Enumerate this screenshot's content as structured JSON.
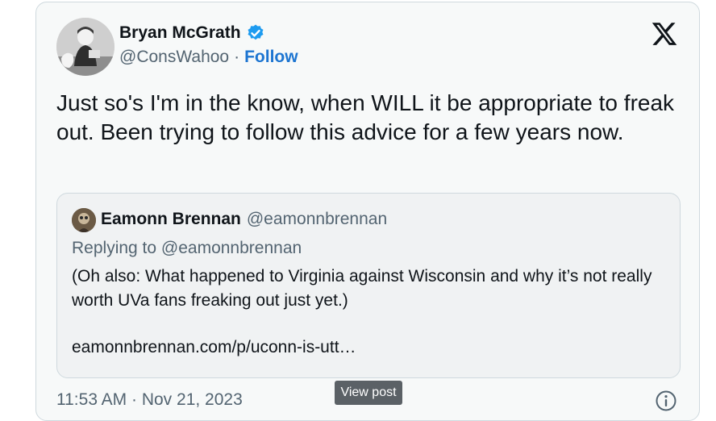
{
  "author": {
    "name": "Bryan McGrath",
    "handle": "@ConsWahoo",
    "separator": "·",
    "follow_label": "Follow",
    "verified_icon": "verified-badge-icon"
  },
  "tweet": {
    "text": "Just so's I'm in the know, when WILL it be appropriate to freak out. Been trying to follow this advice for a few years now."
  },
  "quoted": {
    "name": "Eamonn Brennan",
    "handle": "@eamonnbrennan",
    "replying_to": "Replying to @eamonnbrennan",
    "text": "(Oh also: What happened to Virginia against Wisconsin and why it’s not really worth UVa fans freaking out just yet.)",
    "link": "eamonnbrennan.com/p/uconn-is-utt…"
  },
  "meta": {
    "timestamp": "11:53 AM · Nov 21, 2023",
    "view_post_label": "View post"
  },
  "colors": {
    "accent": "#1d75d1",
    "verified": "#1d9bf0",
    "muted": "#536471",
    "text": "#0f1419"
  }
}
